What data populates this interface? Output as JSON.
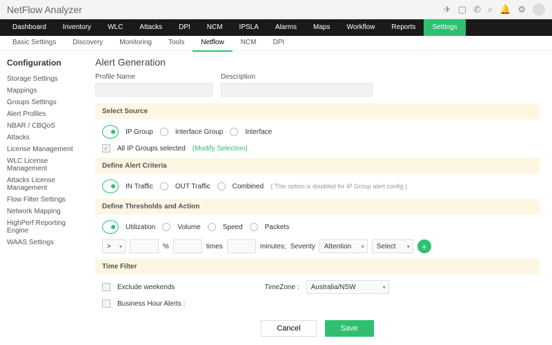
{
  "brand": "NetFlow Analyzer",
  "nav1": [
    "Dashboard",
    "Inventory",
    "WLC",
    "Attacks",
    "DPI",
    "NCM",
    "IPSLA",
    "Alarms",
    "Maps",
    "Workflow",
    "Reports",
    "Settings"
  ],
  "nav1_active": "Settings",
  "nav2": [
    "Basic Settings",
    "Discovery",
    "Monitoring",
    "Tools",
    "Netflow",
    "NCM",
    "DPI"
  ],
  "nav2_active": "Netflow",
  "side_title": "Configuration",
  "side": [
    "Storage Settings",
    "Mappings",
    "Groups Settings",
    "Alert Profiles",
    "NBAR / CBQoS",
    "Attacks",
    "License Management",
    "WLC License Management",
    "Attacks License Management",
    "Flow Filter Settings",
    "Network Mapping",
    "HighPerf Reporting Engine",
    "WAAS Settings"
  ],
  "page_title": "Alert Generation",
  "profile": {
    "name_label": "Profile Name",
    "name_value": "",
    "desc_label": "Description",
    "desc_value": ""
  },
  "src": {
    "header": "Select Source",
    "options": [
      "IP Group",
      "Interface Group",
      "Interface"
    ],
    "selected": "IP Group",
    "all_label": "All IP Groups selected",
    "modify": "(Modify Selection)"
  },
  "criteria": {
    "header": "Define Alert Criteria",
    "options": [
      "IN Traffic",
      "OUT Traffic",
      "Combined"
    ],
    "selected": "IN Traffic",
    "disabled_note": "( This option is disabled for IP Group alert config.)"
  },
  "thr": {
    "header": "Define Thresholds and Action",
    "options": [
      "Utilization",
      "Volume",
      "Speed",
      "Packets"
    ],
    "selected": "Utilization",
    "op": ">",
    "pct_val": "",
    "pct_unit": "%",
    "times_val": "",
    "times_unit": "times",
    "min_val": "",
    "min_unit": "minutes;",
    "sev_label": "Severity",
    "sev_val": "Attention",
    "act_val": "Select"
  },
  "time": {
    "header": "Time Filter",
    "exclude": "Exclude weekends",
    "tz_label": "TimeZone :",
    "tz_val": "Australia/NSW",
    "bh": "Business Hour Alerts :"
  },
  "btn": {
    "cancel": "Cancel",
    "save": "Save"
  }
}
